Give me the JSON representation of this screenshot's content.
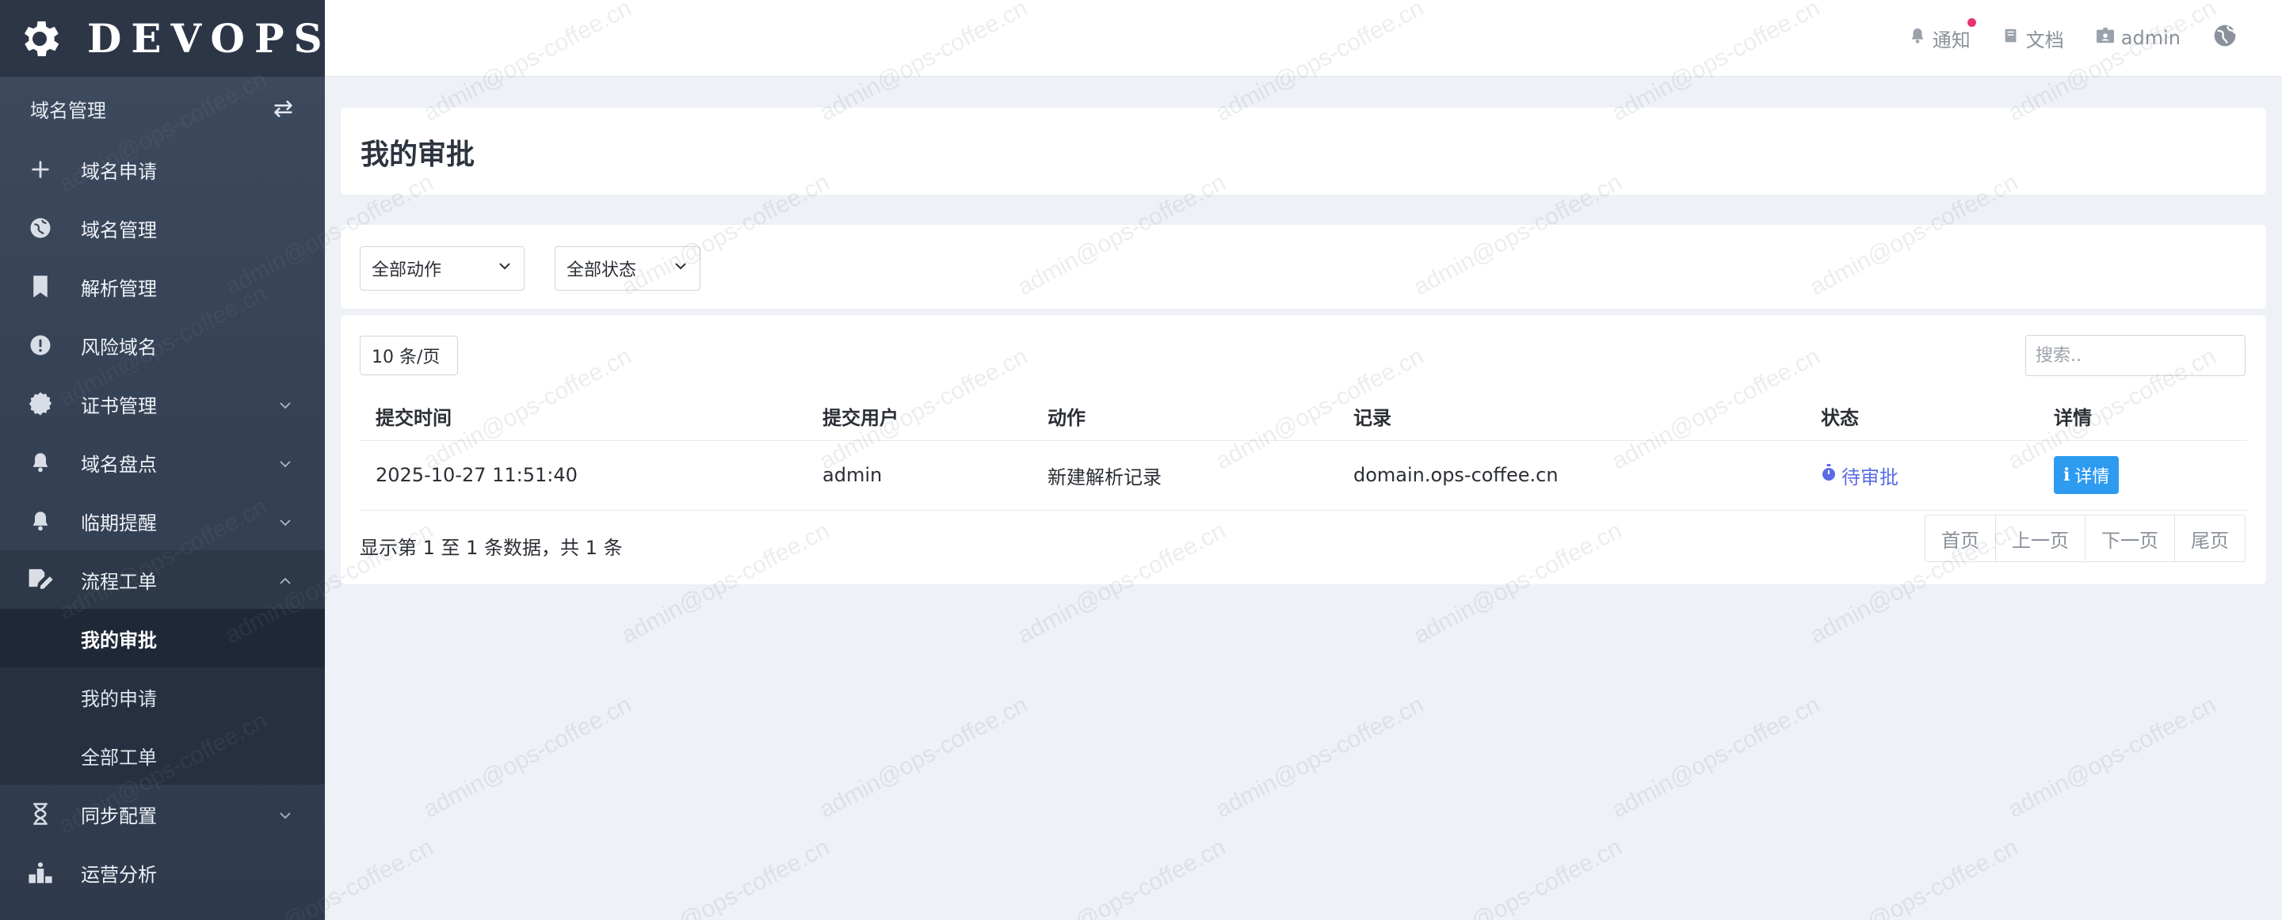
{
  "brand": {
    "name": "DEVOPS",
    "icon": "gear-icon"
  },
  "sidebar": {
    "section_title": "域名管理",
    "section_icon": "swap-icon",
    "items": [
      {
        "label": "域名申请",
        "icon": "plus-icon",
        "has_children": false
      },
      {
        "label": "域名管理",
        "icon": "globe-icon",
        "has_children": false
      },
      {
        "label": "解析管理",
        "icon": "bookmark-icon",
        "has_children": false
      },
      {
        "label": "风险域名",
        "icon": "alert-circle-icon",
        "has_children": false
      },
      {
        "label": "证书管理",
        "icon": "certificate-icon",
        "has_children": true
      },
      {
        "label": "域名盘点",
        "icon": "bell-icon",
        "has_children": true
      },
      {
        "label": "临期提醒",
        "icon": "bell-icon",
        "has_children": true
      },
      {
        "label": "流程工单",
        "icon": "edit-doc-icon",
        "has_children": true,
        "open": true,
        "children": [
          {
            "label": "我的审批",
            "active": true
          },
          {
            "label": "我的申请",
            "active": false
          },
          {
            "label": "全部工单",
            "active": false
          }
        ]
      },
      {
        "label": "同步配置",
        "icon": "hourglass-icon",
        "has_children": true
      },
      {
        "label": "运营分析",
        "icon": "bar-chart-icon",
        "has_children": false
      }
    ]
  },
  "topbar": {
    "notify": "通知",
    "docs": "文档",
    "user": "admin",
    "has_notification": true
  },
  "page": {
    "title": "我的审批"
  },
  "filters": {
    "action": "全部动作",
    "status": "全部状态"
  },
  "table": {
    "page_size": "10 条/页",
    "search_placeholder": "搜索..",
    "columns": [
      "提交时间",
      "提交用户",
      "动作",
      "记录",
      "状态",
      "详情"
    ],
    "rows": [
      {
        "time": "2025-10-27 11:51:40",
        "user": "admin",
        "action": "新建解析记录",
        "record": "domain.ops-coffee.cn",
        "status": "待审批",
        "detail": "详情"
      }
    ],
    "summary": "显示第 1 至 1 条数据，共 1 条",
    "pager": [
      "首页",
      "上一页",
      "下一页",
      "尾页"
    ]
  },
  "watermark": "admin@ops-coffee.cn",
  "colors": {
    "sidebar": "#364256",
    "accent": "#2d9bf0",
    "pending": "#5b6be8",
    "notify_dot": "#e8356d"
  }
}
